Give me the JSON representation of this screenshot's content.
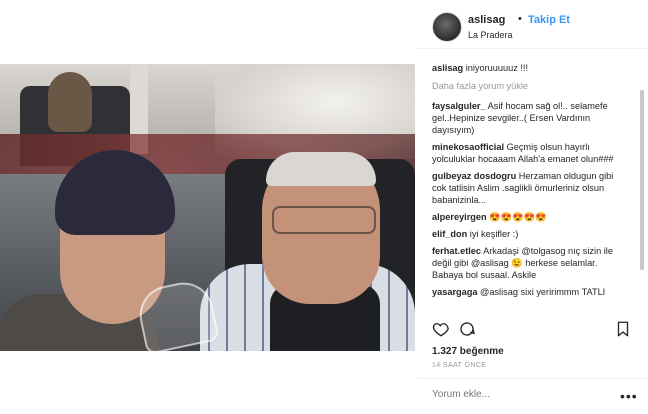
{
  "header": {
    "username": "aslisag",
    "separator": "•",
    "follow_label": "Takip Et",
    "location": "La Pradera"
  },
  "caption": {
    "user": "aslisag",
    "text": "iniyoruuuuuz !!!"
  },
  "load_more_label": "Daha fazla yorum yükle",
  "comments": [
    {
      "user": "faysalguler_",
      "text": "Asif hocam sağ ol!.. selamefe gel..Hepinize sevgiler..( Ersen Vardının dayısıyım)"
    },
    {
      "user": "minekosaofficial",
      "text": "Geçmiş olsun hayırlı yolculuklar hocaaam Allah'a emanet olun###"
    },
    {
      "user": "gulbeyaz dosdogru",
      "text": "Herzaman oldugun gibi cok tatlisin Aslim .saglikli ömurleriniz olsun babanizinla..."
    },
    {
      "user": "alpereyirgen",
      "text": "😍😍😍😍😍"
    },
    {
      "user": "elif_don",
      "text": "iyi keşifler :)"
    },
    {
      "user": "ferhat.etlec",
      "text": "Arkadaşi @tolgasog nıç sizin ile değil gibi @aslisag 😉 herkese selamlar. Babaya bol susaal. Askile"
    },
    {
      "user": "yasargaga",
      "text": "@aslisag sixi yeririmmm TATLI"
    }
  ],
  "likes_text": "1.327 beğenme",
  "time_ago": "14 SAAT ÖNCE",
  "comment_placeholder": "Yorum ekle...",
  "more_options": "•••",
  "colors": {
    "follow": "#3897f0",
    "text": "#262626",
    "muted": "#999999"
  },
  "icons": [
    "heart-icon",
    "comment-icon",
    "bookmark-icon"
  ]
}
